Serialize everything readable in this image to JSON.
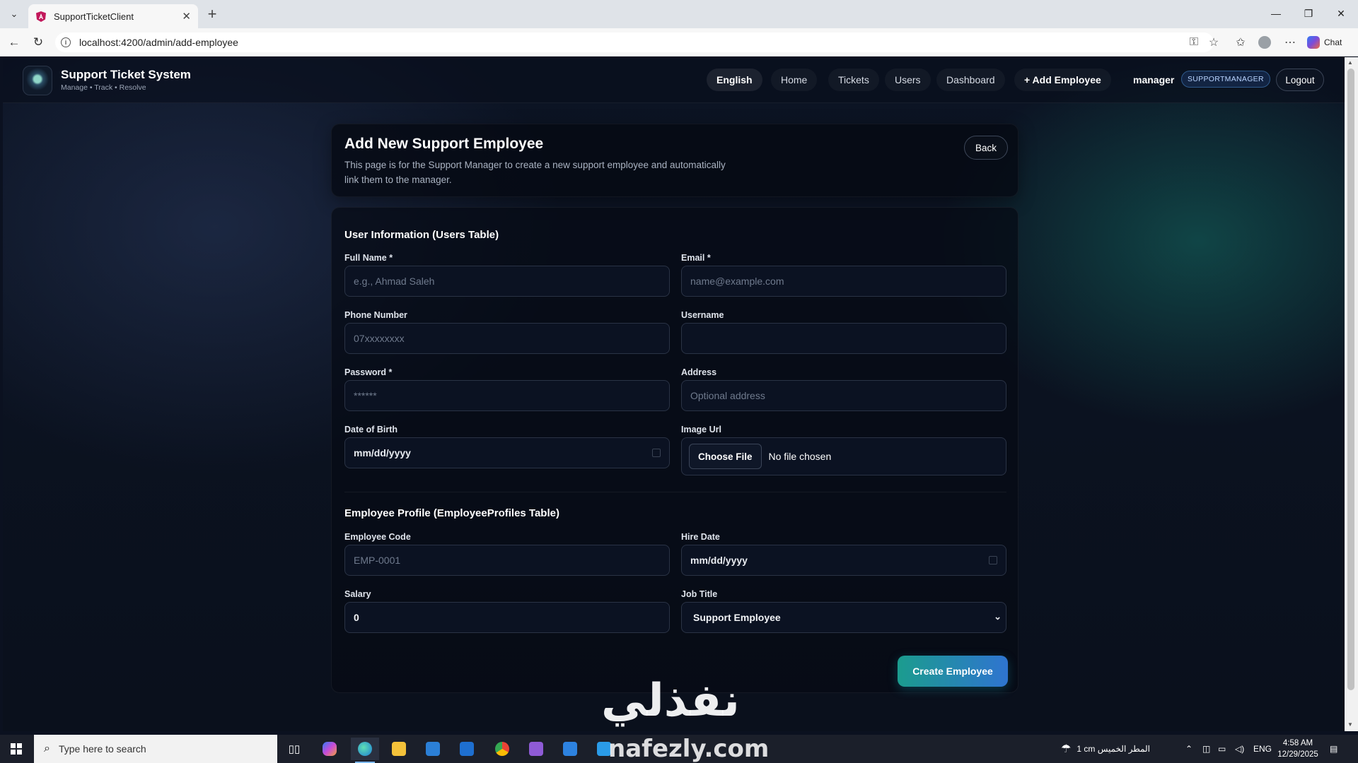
{
  "browser": {
    "tab_title": "SupportTicketClient",
    "url": "localhost:4200/admin/add-employee",
    "chat_label": "Chat"
  },
  "app": {
    "brand_title": "Support Ticket System",
    "brand_subtitle": "Manage • Track • Resolve",
    "nav": {
      "language": "English",
      "home": "Home",
      "tickets": "Tickets",
      "users": "Users",
      "dashboard": "Dashboard",
      "add_employee": "+ Add Employee"
    },
    "user_name": "manager",
    "role": "SUPPORTMANAGER",
    "logout": "Logout"
  },
  "page": {
    "title": "Add New Support Employee",
    "description": "This page is for the Support Manager to create a new support employee and automatically link them to the manager.",
    "back": "Back"
  },
  "form": {
    "user_section_title": "User Information (Users Table)",
    "full_name": {
      "label": "Full Name *",
      "placeholder": "e.g., Ahmad Saleh"
    },
    "email": {
      "label": "Email *",
      "placeholder": "name@example.com"
    },
    "phone": {
      "label": "Phone Number",
      "placeholder": "07xxxxxxxx"
    },
    "username": {
      "label": "Username",
      "placeholder": ""
    },
    "password": {
      "label": "Password *",
      "placeholder": "******"
    },
    "address": {
      "label": "Address",
      "placeholder": "Optional address"
    },
    "dob": {
      "label": "Date of Birth",
      "value": "mm/dd/yyyy"
    },
    "image_url": {
      "label": "Image Url",
      "button": "Choose File",
      "status": "No file chosen"
    },
    "profile_section_title": "Employee Profile (EmployeeProfiles Table)",
    "employee_code": {
      "label": "Employee Code",
      "placeholder": "EMP-0001"
    },
    "hire_date": {
      "label": "Hire Date",
      "value": "mm/dd/yyyy"
    },
    "salary": {
      "label": "Salary",
      "value": "0"
    },
    "job_title": {
      "label": "Job Title",
      "value": "Support Employee"
    },
    "submit": "Create Employee"
  },
  "watermark": {
    "arabic": "نفذلي",
    "latin": "nafezly.com"
  },
  "taskbar": {
    "search_placeholder": "Type here to search",
    "weather": "1 cm المطر الخميس",
    "language": "ENG",
    "time": "4:58 AM",
    "date": "12/29/2025"
  },
  "colors": {
    "accent_start": "#1b9c8e",
    "accent_end": "#2f74d0",
    "background": "#0b1120"
  }
}
